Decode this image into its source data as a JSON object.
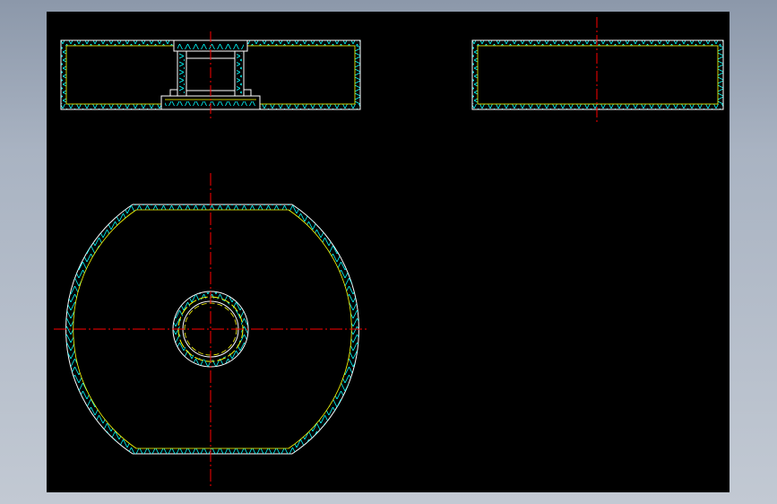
{
  "viewport": {
    "background": "#000000",
    "frame_background": "#a9b3c2"
  },
  "colors": {
    "outline": "#ffffff",
    "hidden_line": "#ffff00",
    "hatch": "#00ffff",
    "center_line": "#ff0000"
  },
  "views": [
    {
      "name": "front-section-view",
      "features": [
        "outer-wall-hatched",
        "central-boss-bore",
        "flange-step"
      ]
    },
    {
      "name": "side-section-view",
      "features": [
        "outer-wall-hatched"
      ]
    },
    {
      "name": "plan-view",
      "features": [
        "truncated-circular-outline",
        "central-bore-ring"
      ]
    }
  ]
}
